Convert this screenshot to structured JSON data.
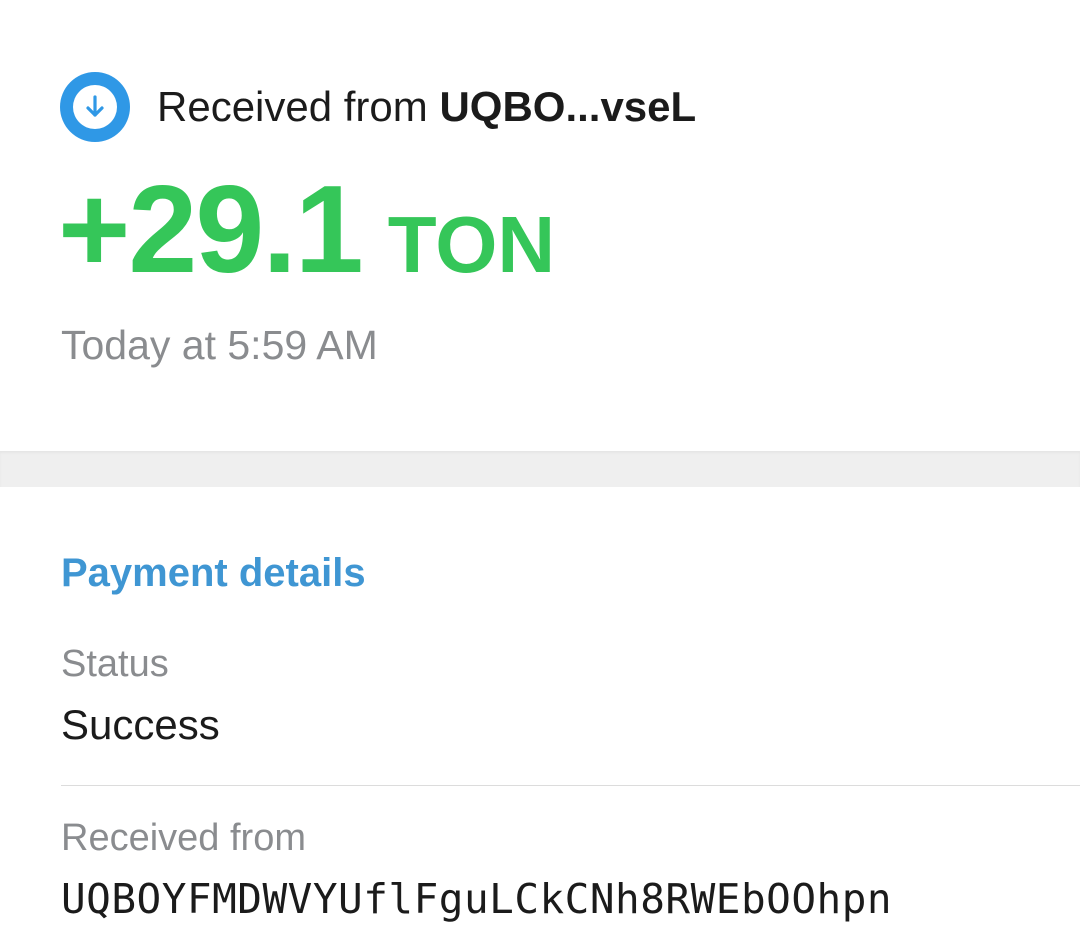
{
  "transaction": {
    "direction_label": "Received from",
    "counterparty_short": "UQBO...vseL",
    "amount": "+29.1",
    "currency": "TON",
    "date": "Today at 5:59 AM",
    "direction_icon": "arrow-down-icon"
  },
  "details": {
    "title": "Payment details",
    "status_label": "Status",
    "status_value": "Success",
    "from_label": "Received from",
    "from_value": "UQBOYFMDWVYUflFguLCkCNh8RWEbOOhpn"
  },
  "colors": {
    "accent_blue": "#2f98e6",
    "section_title_blue": "#3f96d3",
    "amount_green": "#35c659",
    "secondary_text": "#8a8c8f",
    "primary_text": "#1b1b1b",
    "section_gap": "#efefef"
  }
}
